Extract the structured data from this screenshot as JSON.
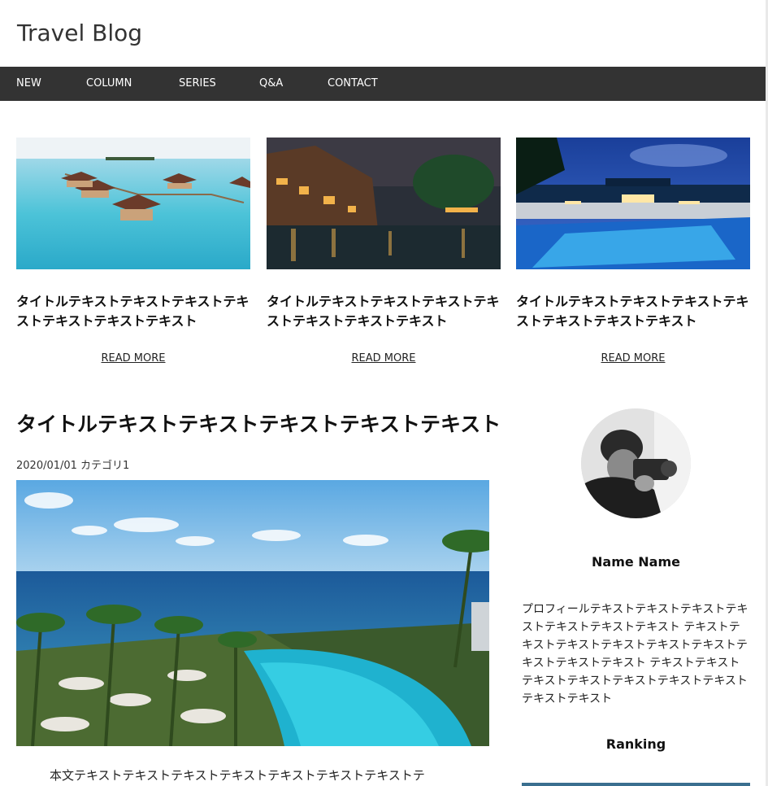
{
  "site": {
    "title": "Travel Blog"
  },
  "nav": {
    "items": [
      "NEW",
      "COLUMN",
      "SERIES",
      "Q&A",
      "CONTACT"
    ]
  },
  "cards": [
    {
      "title": "タイトルテキストテキストテキストテキストテキストテキストテキスト",
      "read_more": "READ MORE",
      "image": "overwater-bungalows-photo"
    },
    {
      "title": "タイトルテキストテキストテキストテキストテキストテキストテキスト",
      "read_more": "READ MORE",
      "image": "canal-town-night-photo"
    },
    {
      "title": "タイトルテキストテキストテキストテキストテキストテキストテキスト",
      "read_more": "READ MORE",
      "image": "resort-pool-night-photo"
    }
  ],
  "article": {
    "title": "タイトルテキストテキストテキストテキストテキスト",
    "date": "2020/01/01",
    "category": "カテゴリ1",
    "hero_image": "ocean-resort-pool-photo",
    "body_text": "本文テキストテキストテキストテキストテキストテキストテキストテ"
  },
  "profile": {
    "avatar_image": "photographer-portrait-photo",
    "name": "Name Name",
    "text": "プロフィールテキストテキストテキストテキストテキストテキストテキスト テキストテキストテキストテキストテキストテキストテキストテキストテキスト テキストテキストテキストテキストテキストテキストテキストテキストテキスト"
  },
  "sidebar": {
    "ranking_heading": "Ranking"
  },
  "colors": {
    "nav_bg": "#333333",
    "ranking_accent": "#3a6f8f"
  }
}
